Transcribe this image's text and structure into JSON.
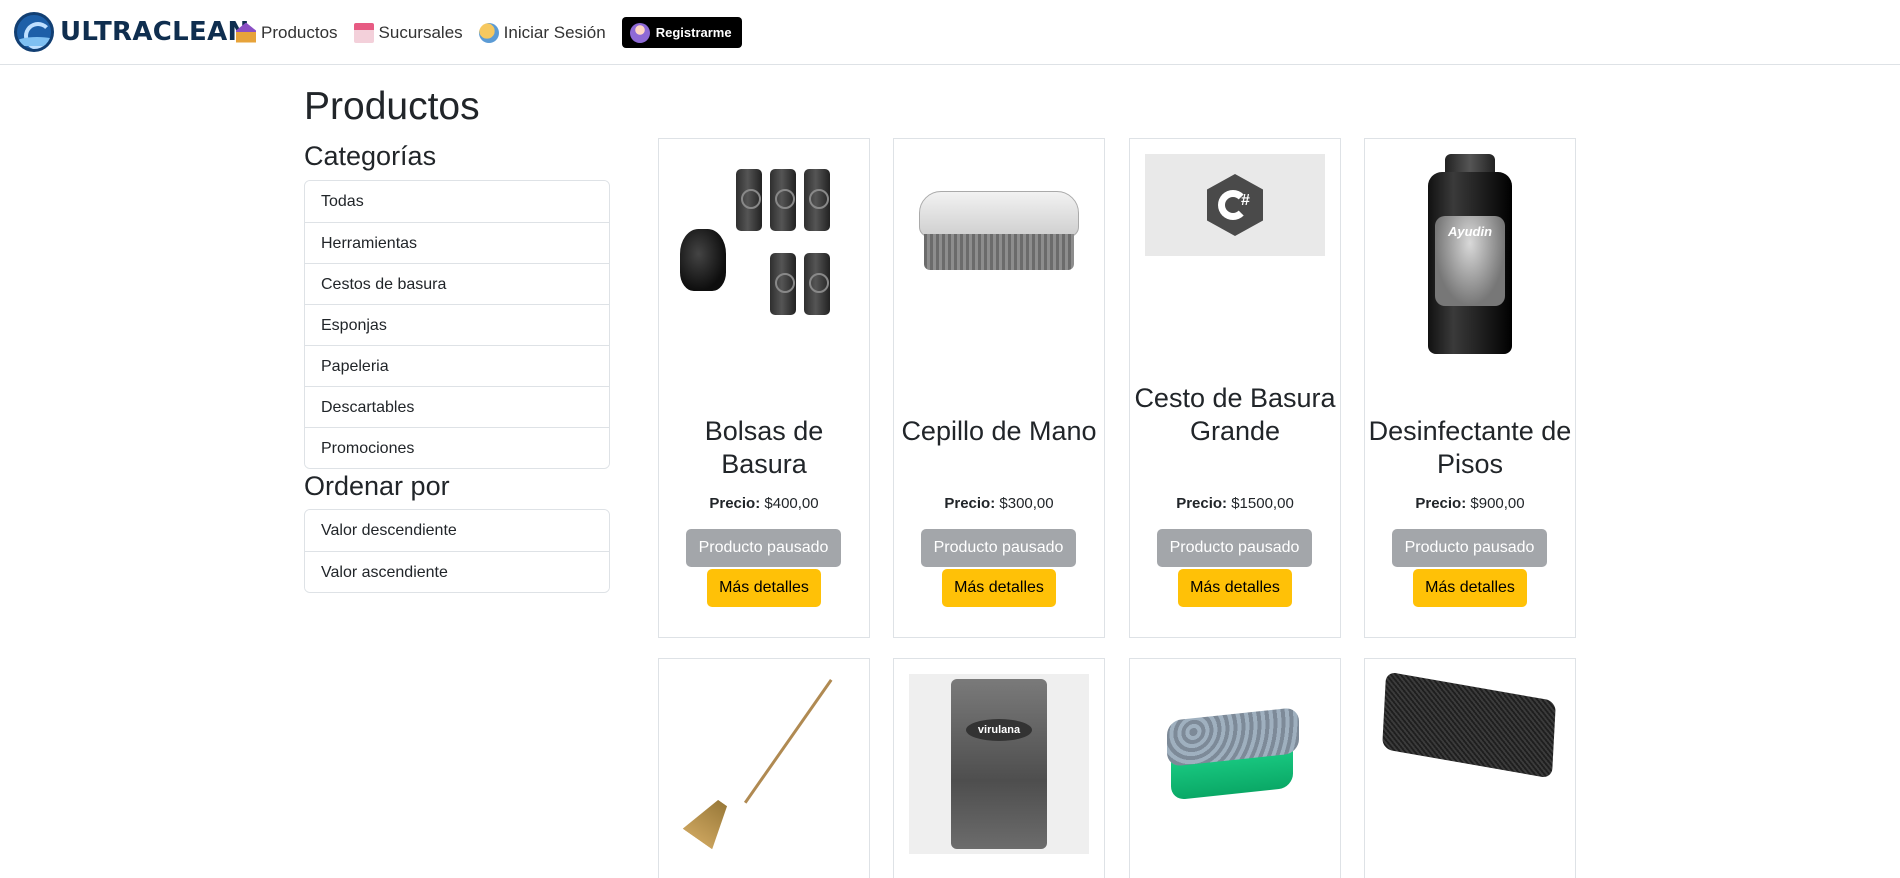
{
  "nav": {
    "brand": "ULTRACLEAN",
    "links": [
      {
        "label": "Productos",
        "icon": "products-house-icon"
      },
      {
        "label": "Sucursales",
        "icon": "store-icon"
      },
      {
        "label": "Iniciar Sesión",
        "icon": "login-globe-icon"
      }
    ],
    "register_label": "Registrarme"
  },
  "page": {
    "title": "Productos",
    "categories_title": "Categorías",
    "categories": [
      "Todas",
      "Herramientas",
      "Cestos de basura",
      "Esponjas",
      "Papeleria",
      "Descartables",
      "Promociones"
    ],
    "sort_title": "Ordenar por",
    "sort_options": [
      "Valor descendiente",
      "Valor ascendiente"
    ]
  },
  "products": [
    {
      "name": "Bolsas de Basura",
      "price_label": "Precio:",
      "price": "$400,00",
      "status_button": "Producto pausado",
      "details_button": "Más detalles"
    },
    {
      "name": "Cepillo de Mano",
      "price_label": "Precio:",
      "price": "$300,00",
      "status_button": "Producto pausado",
      "details_button": "Más detalles"
    },
    {
      "name": "Cesto de Basura Grande",
      "price_label": "Precio:",
      "price": "$1500,00",
      "status_button": "Producto pausado",
      "details_button": "Más detalles"
    },
    {
      "name": "Desinfectante de Pisos",
      "price_label": "Precio:",
      "price": "$900,00",
      "status_button": "Producto pausado",
      "details_button": "Más detalles"
    }
  ],
  "images": {
    "product_bottle_brand": "Ayudin",
    "product_pack_brand": "virulana",
    "csharp_mark": "#"
  },
  "colors": {
    "register_bg": "#000000",
    "paused_button": "#a3a6aa",
    "details_button": "#ffc107",
    "border": "#dee2e6"
  }
}
